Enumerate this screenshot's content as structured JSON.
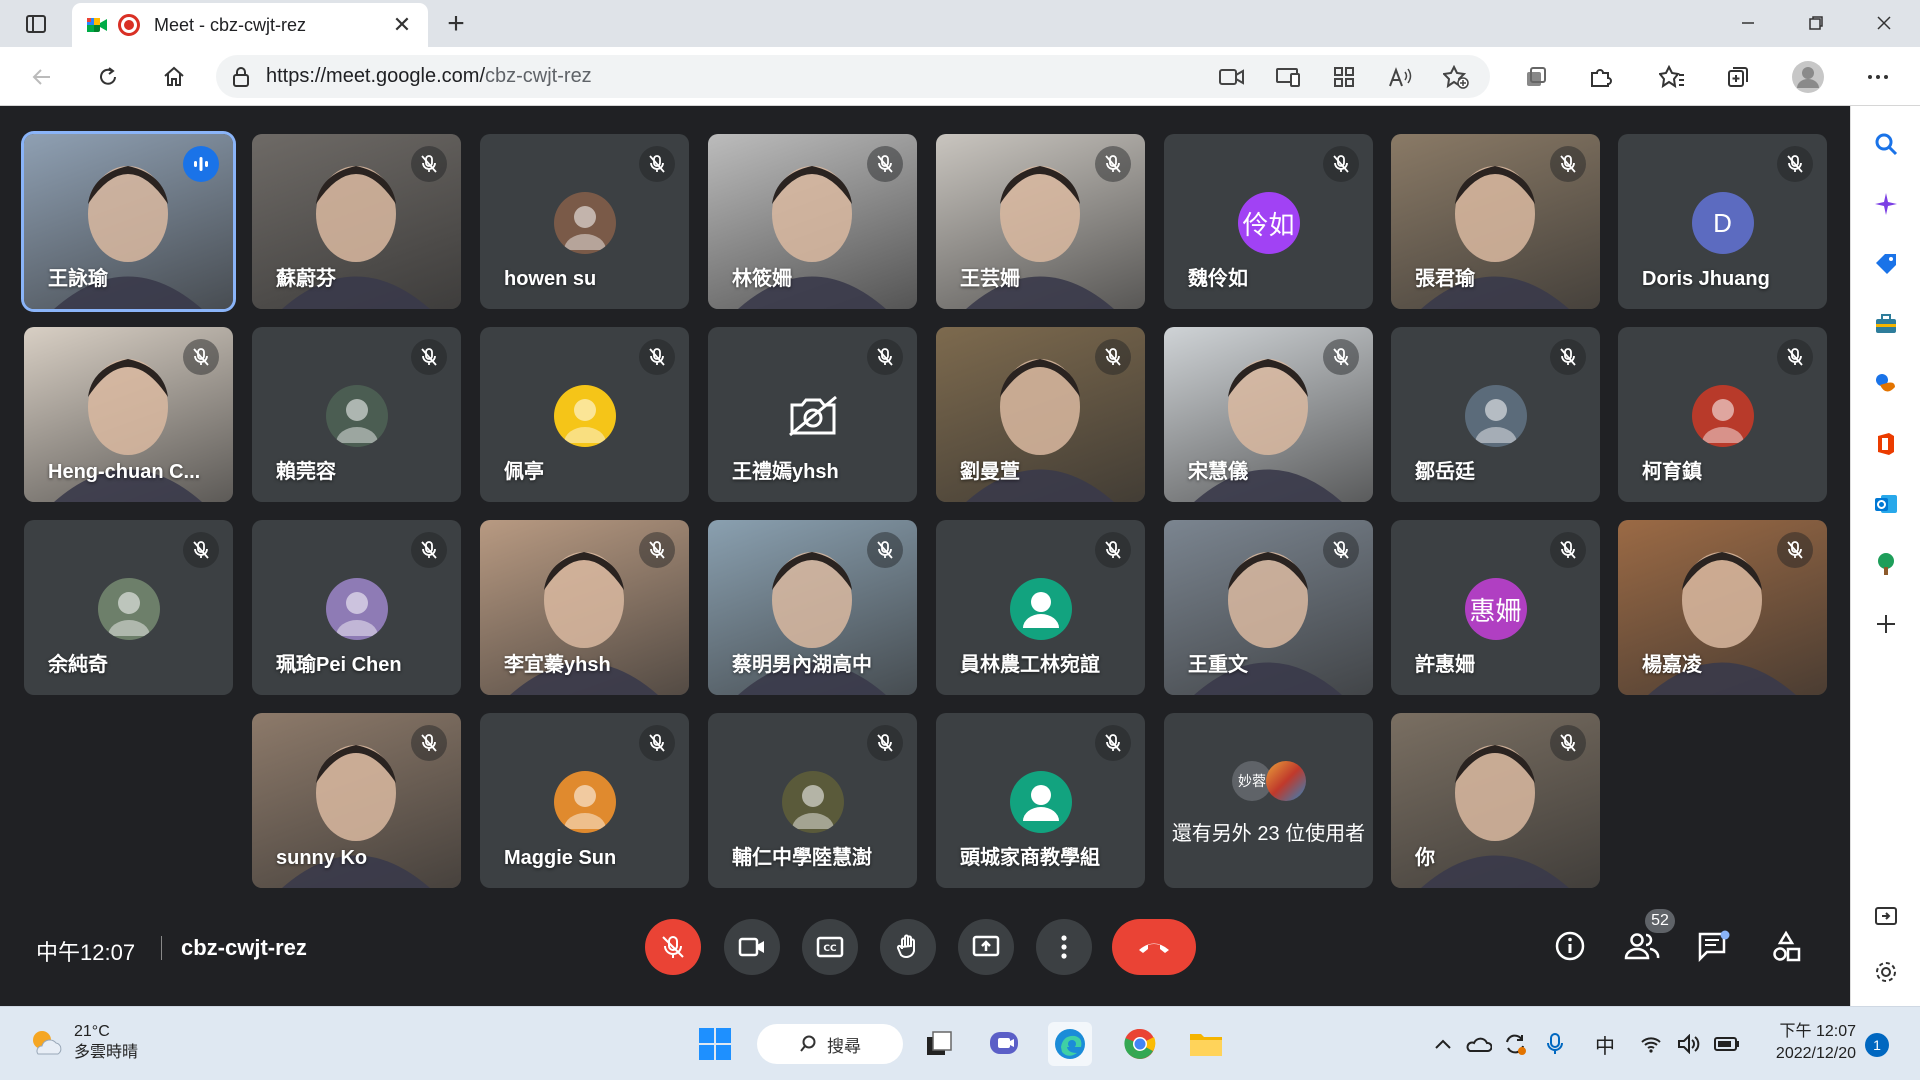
{
  "browser": {
    "tab_title": "Meet - cbz-cwjt-rez",
    "url_host": "https://meet.google.com/",
    "url_path": "cbz-cwjt-rez"
  },
  "meeting": {
    "time": "中午12:07",
    "code": "cbz-cwjt-rez",
    "participant_count": "52",
    "more_users_text": "還有另外 23 位使用者",
    "more_users_avatar": "妙蓉"
  },
  "tiles": [
    {
      "name": "王詠瑜",
      "type": "video",
      "bg": "#8fa0b3",
      "active": true,
      "speaking": true
    },
    {
      "name": "蘇蔚芬",
      "type": "video",
      "bg": "#6e6a66"
    },
    {
      "name": "howen su",
      "type": "avatar",
      "avatar_bg": "#7a5a48",
      "avatar_text": ""
    },
    {
      "name": "林筱姍",
      "type": "video",
      "bg": "#bcbcbc"
    },
    {
      "name": "王芸姍",
      "type": "video",
      "bg": "#c9c5bf"
    },
    {
      "name": "魏伶如",
      "type": "avatar",
      "avatar_bg": "#a142f4",
      "avatar_text": "伶如"
    },
    {
      "name": "張君瑜",
      "type": "video",
      "bg": "#8a7a66"
    },
    {
      "name": "Doris Jhuang",
      "type": "avatar",
      "avatar_bg": "#5c6bc0",
      "avatar_text": "D"
    },
    {
      "name": "Heng-chuan C...",
      "type": "video",
      "bg": "#d8cfc4"
    },
    {
      "name": "賴莞容",
      "type": "avatar",
      "avatar_bg": "#4b5d52",
      "avatar_text": ""
    },
    {
      "name": "佩亭",
      "type": "avatar",
      "avatar_bg": "#f5c518",
      "avatar_text": ""
    },
    {
      "name": "王禮嫣yhsh",
      "type": "camoff"
    },
    {
      "name": "劉曼萱",
      "type": "video",
      "bg": "#7d6a4e"
    },
    {
      "name": "宋慧儀",
      "type": "video",
      "bg": "#cfd3d6"
    },
    {
      "name": "鄒岳廷",
      "type": "avatar",
      "avatar_bg": "#5b6b7a",
      "avatar_text": ""
    },
    {
      "name": "柯育鎮",
      "type": "avatar",
      "avatar_bg": "#b83a2a",
      "avatar_text": ""
    },
    {
      "name": "余純奇",
      "type": "avatar",
      "avatar_bg": "#6d7f6a",
      "avatar_text": ""
    },
    {
      "name": "珮瑜Pei Chen",
      "type": "avatar",
      "avatar_bg": "#8e7bb5",
      "avatar_text": ""
    },
    {
      "name": "李宜蓁yhsh",
      "type": "video",
      "bg": "#b89a82"
    },
    {
      "name": "蔡明男內湖高中",
      "type": "video",
      "bg": "#8aa0b0"
    },
    {
      "name": "員林農工林宛誼",
      "type": "avatar",
      "avatar_bg": "#12a37f",
      "avatar_text": ""
    },
    {
      "name": "王重文",
      "type": "video",
      "bg": "#7b8590"
    },
    {
      "name": "許惠姍",
      "type": "avatar",
      "avatar_bg": "#b03fc2",
      "avatar_text": "惠姍"
    },
    {
      "name": "楊嘉凌",
      "type": "video",
      "bg": "#9b6a45"
    },
    {
      "name": "sunny Ko",
      "type": "video",
      "bg": "#8d7a6a"
    },
    {
      "name": "Maggie Sun",
      "type": "avatar",
      "avatar_bg": "#e08a2e",
      "avatar_text": ""
    },
    {
      "name": "輔仁中學陸慧澍",
      "type": "avatar",
      "avatar_bg": "#5a5a3a",
      "avatar_text": ""
    },
    {
      "name": "頭城家商教學組",
      "type": "avatar",
      "avatar_bg": "#12a37f",
      "avatar_text": ""
    },
    {
      "name": "",
      "type": "more"
    },
    {
      "name": "你",
      "type": "video",
      "bg": "#7a6f62"
    }
  ],
  "taskbar": {
    "temp": "21°C",
    "weather": "多雲時晴",
    "search": "搜尋",
    "ime": "中",
    "time": "下午 12:07",
    "date": "2022/12/20",
    "notifications": "1"
  }
}
